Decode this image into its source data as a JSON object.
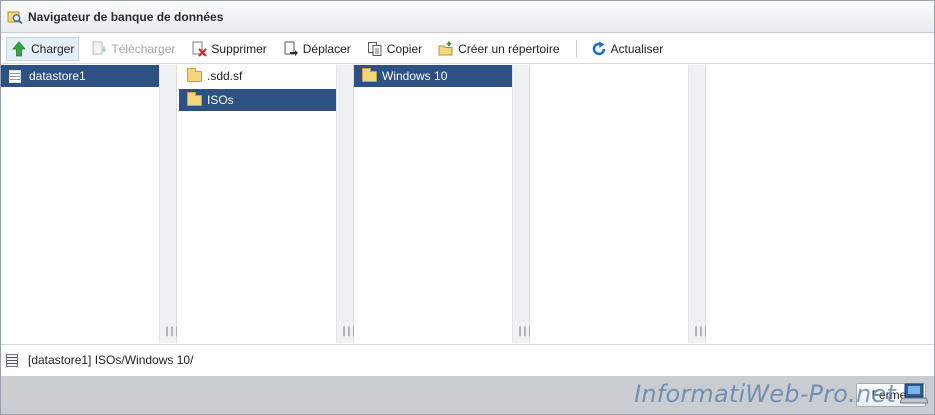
{
  "window": {
    "title": "Navigateur de banque de données",
    "title_icon": "datastore-browser-icon"
  },
  "toolbar": {
    "upload": {
      "label": "Charger",
      "icon": "upload-arrow-icon",
      "color": "#2e9b3a"
    },
    "download": {
      "label": "Télécharger",
      "icon": "download-icon"
    },
    "delete": {
      "label": "Supprimer",
      "icon": "delete-icon",
      "color": "#d0232a"
    },
    "move": {
      "label": "Déplacer",
      "icon": "move-icon"
    },
    "copy": {
      "label": "Copier",
      "icon": "copy-icon"
    },
    "create_dir": {
      "label": "Créer un répertoire",
      "icon": "new-folder-icon"
    },
    "refresh": {
      "label": "Actualiser",
      "icon": "refresh-icon",
      "color": "#1d6fc1"
    }
  },
  "columns": [
    {
      "items": [
        {
          "label": "datastore1",
          "icon": "datastore-icon",
          "selected": true
        }
      ]
    },
    {
      "items": [
        {
          "label": ".sdd.sf",
          "icon": "folder-icon",
          "selected": false
        },
        {
          "label": "ISOs",
          "icon": "folder-icon",
          "selected": true
        }
      ]
    },
    {
      "items": [
        {
          "label": "Windows 10",
          "icon": "folder-icon",
          "selected": true
        }
      ]
    },
    {
      "items": []
    },
    {
      "items": []
    }
  ],
  "status": {
    "path": "[datastore1] ISOs/Windows 10/"
  },
  "footer": {
    "close_label": "Fermer"
  },
  "watermark": {
    "text": "InformatiWeb-Pro.net"
  },
  "colors": {
    "selection": "#2c5182",
    "accent_blue": "#1d6fc1"
  }
}
